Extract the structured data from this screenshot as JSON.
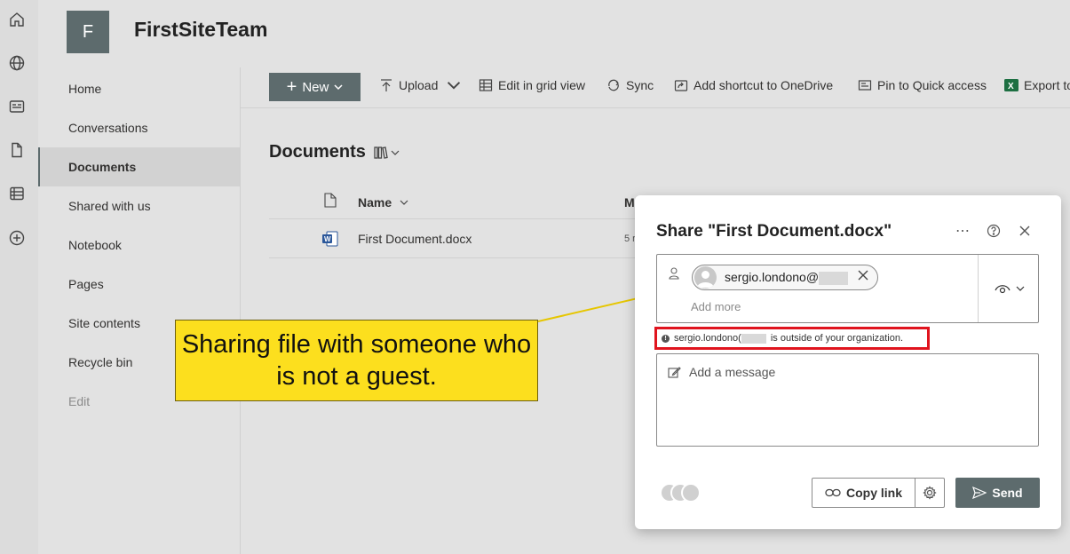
{
  "site": {
    "logo_letter": "F",
    "title": "FirstSiteTeam"
  },
  "rail": {
    "icons": [
      "home-icon",
      "globe-icon",
      "news-icon",
      "file-icon",
      "list-icon",
      "add-circle-icon"
    ]
  },
  "nav": {
    "items": [
      {
        "label": "Home"
      },
      {
        "label": "Conversations"
      },
      {
        "label": "Documents"
      },
      {
        "label": "Shared with us"
      },
      {
        "label": "Notebook"
      },
      {
        "label": "Pages"
      },
      {
        "label": "Site contents"
      },
      {
        "label": "Recycle bin"
      },
      {
        "label": "Edit"
      }
    ],
    "active": "Documents"
  },
  "commands": {
    "new_label": "New",
    "upload": "Upload",
    "edit_grid": "Edit in grid view",
    "sync": "Sync",
    "shortcut": "Add shortcut to OneDrive",
    "pin": "Pin to Quick access",
    "export": "Export to"
  },
  "library": {
    "title": "Documents",
    "name_header": "Name",
    "modified_header_partial": "M",
    "files": [
      {
        "name": "First Document.docx",
        "modified_partial": "5 r"
      }
    ]
  },
  "callout": {
    "text": "Sharing file with someone who is not a guest."
  },
  "share_dialog": {
    "title": "Share \"First Document.docx\"",
    "recipient": "sergio.londono@",
    "add_more_placeholder": "Add more",
    "warning_prefix": "sergio.londono(",
    "warning_suffix": "is outside of your organization.",
    "message_placeholder": "Add a message",
    "copy_link": "Copy link",
    "send": "Send",
    "accent_color": "#5d6b6d",
    "warning_border_color": "#e0141e"
  }
}
